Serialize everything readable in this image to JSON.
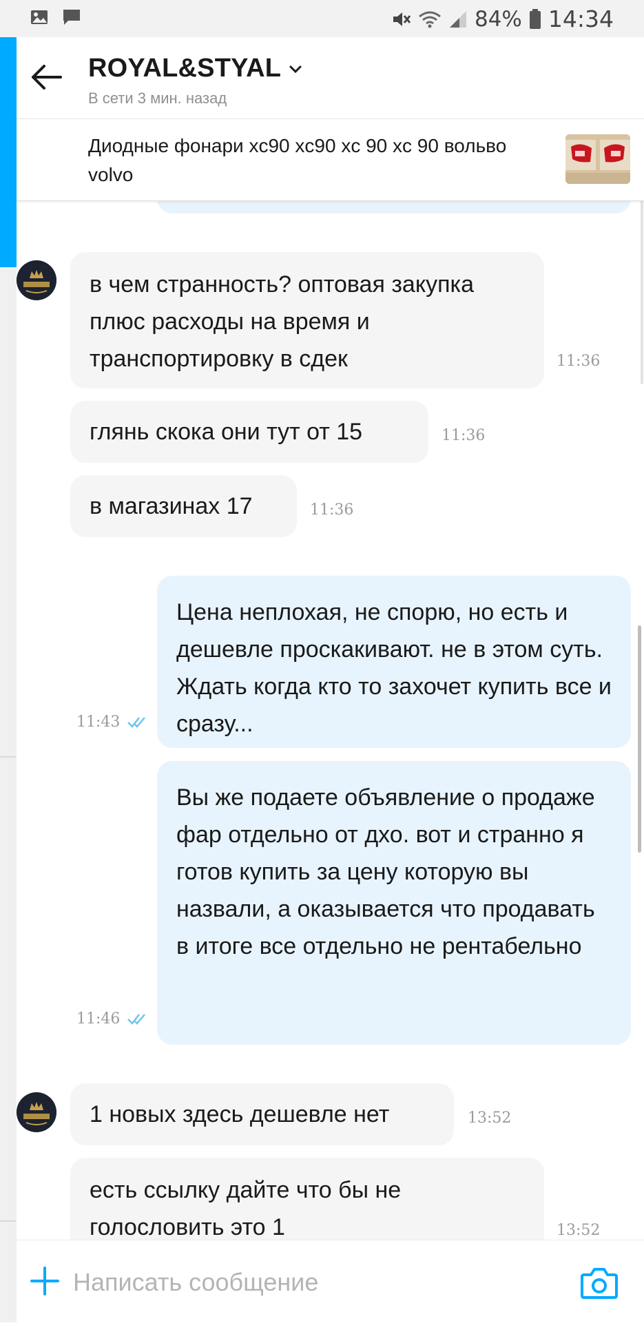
{
  "status_bar": {
    "battery": "84%",
    "time": "14:34",
    "left_icons": [
      "gallery-icon",
      "chat-icon"
    ],
    "right_icons": [
      "mute-icon",
      "wifi-icon",
      "signal-icon",
      "battery-icon"
    ]
  },
  "header": {
    "title": "ROYAL&STYAL",
    "subtitle": "В сети 3 мин. назад"
  },
  "item": {
    "title": "Диодные фонари xc90 xc90 xc 90 xc 90 вольво volvo"
  },
  "messages": [
    {
      "dir": "in",
      "text": "в чем странность? оптовая закупка плюс расходы на время и транспортировку в сдек",
      "time": "11:36"
    },
    {
      "dir": "in",
      "text": "глянь скока они тут от 15",
      "time": "11:36"
    },
    {
      "dir": "in",
      "text": "в магазинах 17",
      "time": "11:36"
    },
    {
      "dir": "out",
      "text": "Цена неплохая, не спорю, но есть и дешевле проскакивают. не в этом суть. Ждать когда кто то захочет купить все и сразу...",
      "time": "11:43"
    },
    {
      "dir": "out",
      "text": "Вы же подаете объявление о продаже фар отдельно от дхо. вот и странно я готов купить за цену которую вы назвали, а оказывается что продавать в итоге все отдельно не рентабельно",
      "time": "11:46"
    },
    {
      "dir": "in",
      "text": "1 новых здесь дешевле нет",
      "time": "13:52"
    },
    {
      "dir": "in",
      "text": "есть ссылку дайте что бы не голословить это 1",
      "time": "13:52"
    }
  ],
  "composer": {
    "placeholder": "Написать сообщение"
  },
  "colors": {
    "accent": "#00aaff",
    "incoming_bubble": "#f5f5f5",
    "outgoing_bubble": "#e8f4fd"
  }
}
